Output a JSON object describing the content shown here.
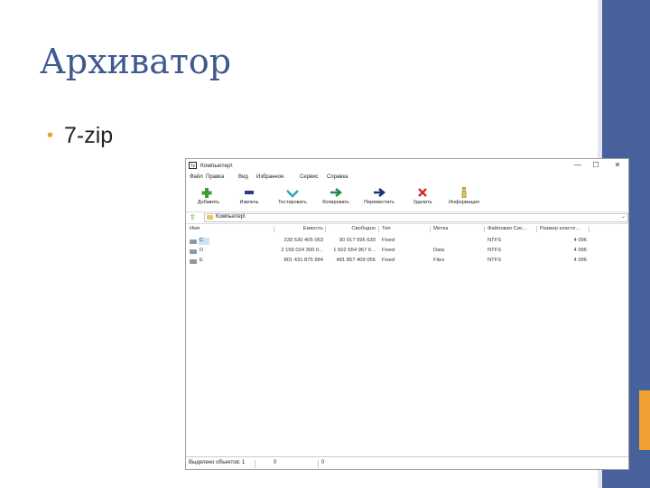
{
  "slide": {
    "title": "Архиватор",
    "bullet": "7-zip"
  },
  "colors": {
    "title": "#3f5a8f",
    "sidebar": "#46619b",
    "accent": "#f0a030"
  },
  "window": {
    "title": "Компьютер\\",
    "app_icon": "7z",
    "controls": {
      "minimize": "—",
      "maximize": "☐",
      "close": "✕"
    },
    "menu": [
      "Файл",
      "Правка",
      "Вид",
      "Избранное",
      "Сервис",
      "Справка"
    ],
    "toolbar": [
      {
        "label": "Добавить",
        "icon": "add-plus-icon"
      },
      {
        "label": "Извлечь",
        "icon": "extract-minus-icon"
      },
      {
        "label": "Тестировать",
        "icon": "test-check-icon"
      },
      {
        "label": "Копировать",
        "icon": "copy-arrow-icon"
      },
      {
        "label": "Переместить",
        "icon": "move-arrow-icon"
      },
      {
        "label": "Удалить",
        "icon": "delete-x-icon"
      },
      {
        "label": "Информация",
        "icon": "info-icon"
      }
    ],
    "address": "Компьютер\\",
    "columns": [
      "Имя",
      "Емкость",
      "Свободно",
      "Тип",
      "Метка",
      "Файловая Сис...",
      "Размер класте..."
    ],
    "rows": [
      {
        "name": "C",
        "capacity": "239 530 405 063",
        "free": "90 017 095 630",
        "type": "Fixed",
        "label": "",
        "fs": "NTFS",
        "cluster": "4 096"
      },
      {
        "name": "D",
        "capacity": "2 199 024 300 0...",
        "free": "1 502 654 967 6...",
        "type": "Fixed",
        "label": "Data",
        "fs": "NTFS",
        "cluster": "4 096"
      },
      {
        "name": "E",
        "capacity": "801 431 875 584",
        "free": "481 857 409 056",
        "type": "Fixed",
        "label": "Files",
        "fs": "NTFS",
        "cluster": "4 096"
      }
    ],
    "status": {
      "label": "Выделено объектов: 1",
      "size": "0",
      "packed": "0"
    }
  }
}
